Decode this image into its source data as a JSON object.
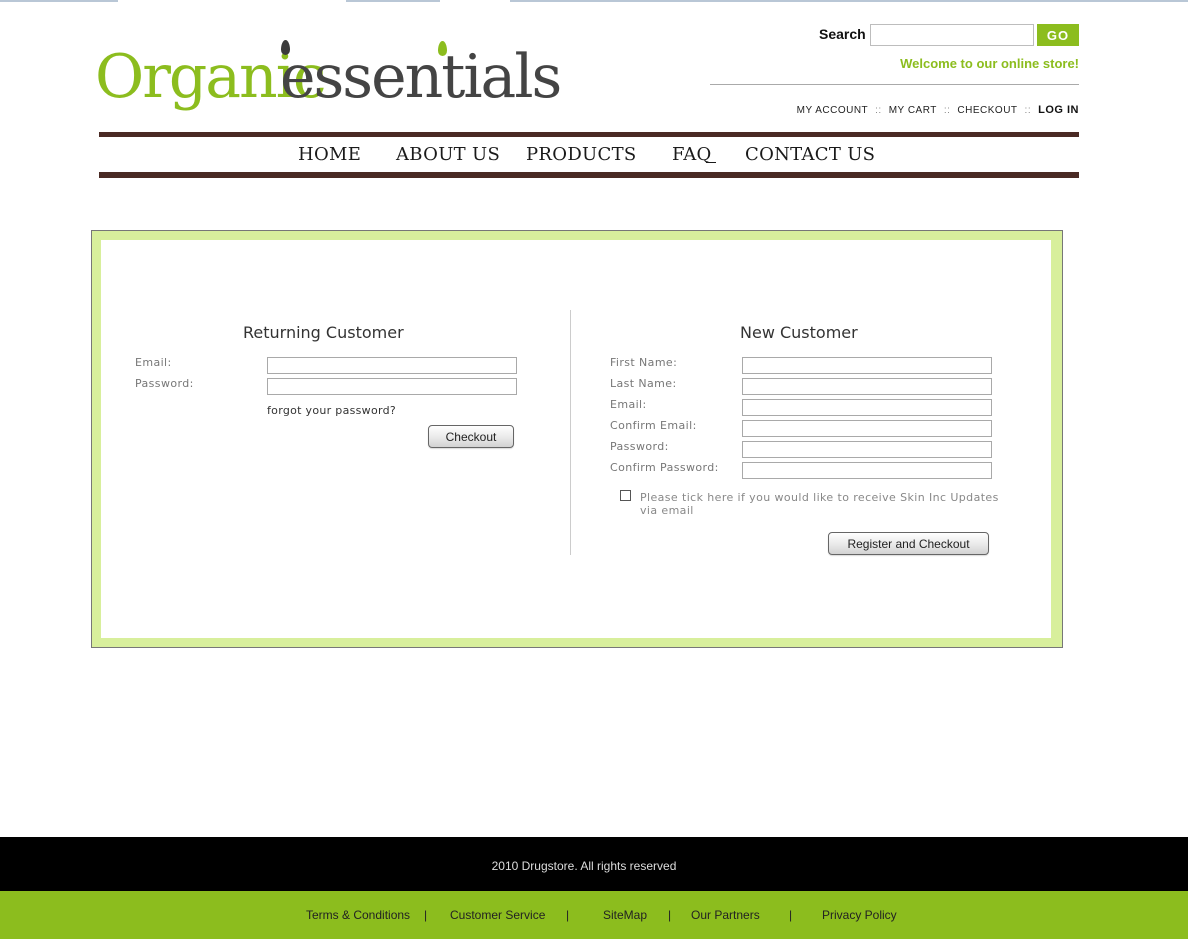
{
  "logo": {
    "part1": "Organic",
    "part2": "essentials"
  },
  "search": {
    "label": "Search",
    "placeholder": "",
    "value": "",
    "button_label": "GO"
  },
  "welcome": "Welcome to our online store!",
  "account_links": {
    "my_account": "MY ACCOUNT",
    "my_cart": "MY CART",
    "checkout": "CHECKOUT",
    "login": "LOG IN",
    "separator": "::"
  },
  "nav": {
    "home": "HOME",
    "about": "ABOUT US",
    "products": "PRODUCTS",
    "faq": "FAQ",
    "contact": "CONTACT US"
  },
  "returning": {
    "title": "Returning Customer",
    "email_label": "Email:",
    "password_label": "Password:",
    "forgot": "forgot your password?",
    "button": "Checkout"
  },
  "new_customer": {
    "title": "New Customer",
    "first_name": "First Name:",
    "last_name": "Last Name:",
    "email": "Email:",
    "confirm_email": "Confirm Email:",
    "password": "Password:",
    "confirm_password": "Confirm Password:",
    "tick_text": "Please tick here if you would like to receive Skin Inc Updates via email",
    "button": "Register and Checkout"
  },
  "footer": {
    "copyright": "2010 Drugstore. All rights reserved",
    "links": [
      "Terms & Conditions",
      "Customer Service",
      "SiteMap",
      "Our Partners",
      "Privacy Policy"
    ],
    "separator": "|"
  },
  "colors": {
    "accent_green": "#8cbd1e",
    "nav_brown": "#4a2a24",
    "panel_green": "#d8ef9c"
  }
}
